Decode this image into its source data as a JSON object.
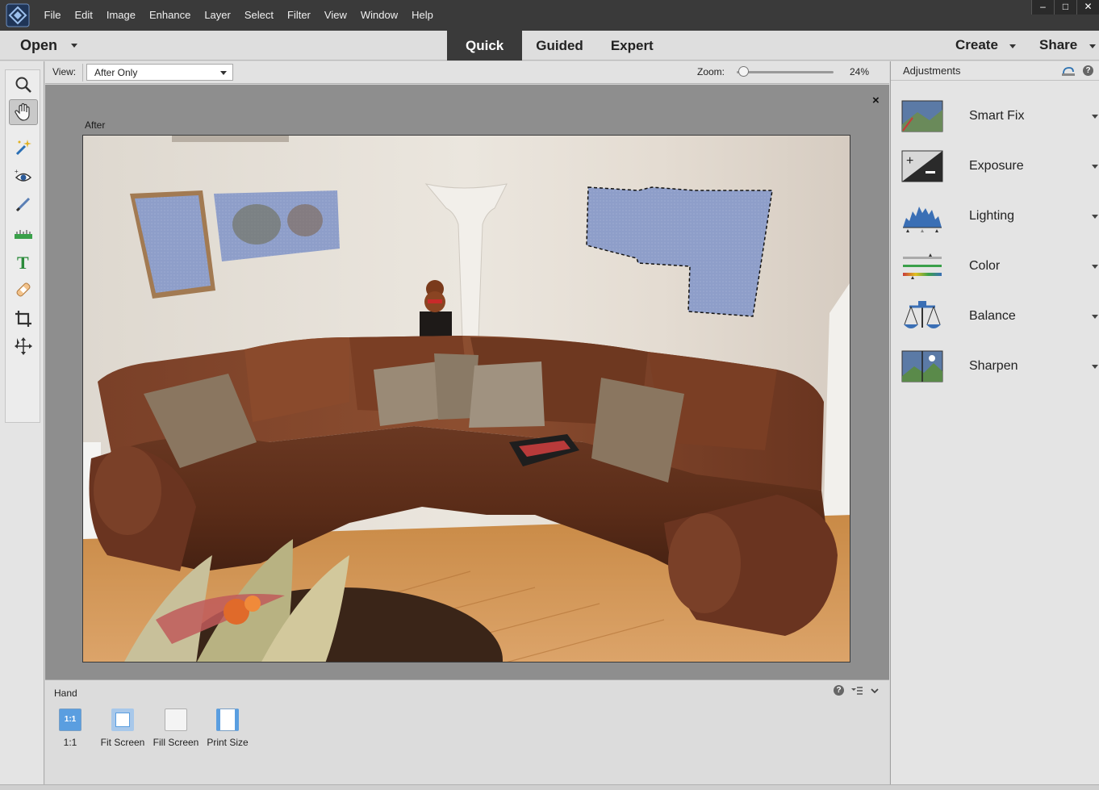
{
  "menu": [
    "File",
    "Edit",
    "Image",
    "Enhance",
    "Layer",
    "Select",
    "Filter",
    "View",
    "Window",
    "Help"
  ],
  "window_controls": {
    "minimize": "‒",
    "maximize": "□",
    "close": "✕"
  },
  "modebar": {
    "open_label": "Open",
    "tabs": [
      "Quick",
      "Guided",
      "Expert"
    ],
    "active_tab": "Quick",
    "create_label": "Create",
    "share_label": "Share"
  },
  "tools": [
    "zoom-tool",
    "hand-tool",
    "quick-selection-tool",
    "red-eye-tool",
    "whiten-teeth-tool",
    "straighten-tool",
    "type-tool",
    "spot-healing-tool",
    "crop-tool",
    "move-tool"
  ],
  "selected_tool": "hand-tool",
  "options": {
    "view_label": "View:",
    "view_value": "After Only",
    "zoom_label": "Zoom:",
    "zoom_value": "24%",
    "zoom_fraction": 0.24
  },
  "canvas": {
    "after_label": "After",
    "close_glyph": "×"
  },
  "hand_panel": {
    "title": "Hand",
    "buttons": [
      "1:1",
      "Fit Screen",
      "Fill Screen",
      "Print Size"
    ],
    "one_to_one_icon": "1:1",
    "help_glyph": "?"
  },
  "adjustments": {
    "title": "Adjustments",
    "items": [
      "Smart Fix",
      "Exposure",
      "Lighting",
      "Color",
      "Balance",
      "Sharpen"
    ]
  },
  "colors": {
    "titlebar": "#3a3a3a",
    "active_tab": "#3a3a3a",
    "canvas_bg": "#8e8e8e",
    "selection_fill": "#8e9ec9"
  }
}
